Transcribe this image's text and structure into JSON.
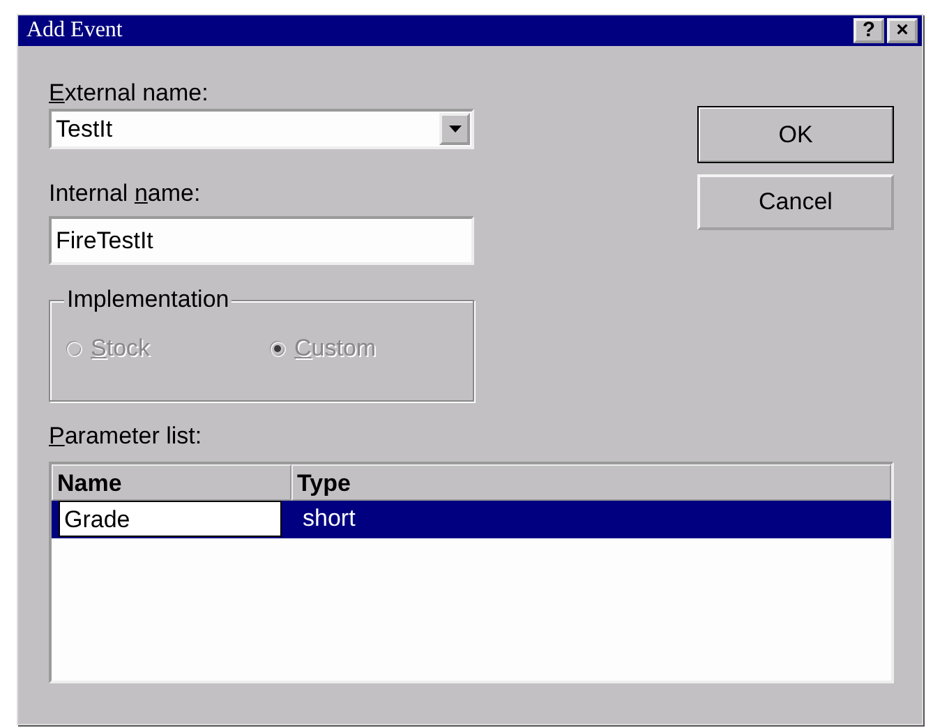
{
  "window": {
    "title": "Add Event",
    "title_buttons": [
      "?",
      "×"
    ]
  },
  "external_name": {
    "label": {
      "key": "E",
      "post": "xternal name:"
    },
    "value": "TestIt"
  },
  "internal_name": {
    "label": {
      "pre": "Internal ",
      "key": "n",
      "post": "ame:"
    },
    "value": "FireTestIt"
  },
  "implementation": {
    "title": "Implementation",
    "options": [
      {
        "label": {
          "key": "S",
          "post": "tock"
        },
        "selected": false,
        "disabled": true
      },
      {
        "label": {
          "key": "C",
          "post": "ustom"
        },
        "selected": true,
        "disabled": true
      }
    ]
  },
  "parameter_list": {
    "label": {
      "key": "P",
      "post": "arameter list:"
    },
    "columns": [
      "Name",
      "Type"
    ],
    "rows": [
      {
        "selected": true,
        "cells": [
          {
            "text": "Grade",
            "editing": true
          },
          {
            "text": "short",
            "editing": false
          }
        ]
      }
    ]
  },
  "buttons": [
    {
      "label": "OK",
      "default": true
    },
    {
      "label": "Cancel",
      "default": false
    }
  ]
}
